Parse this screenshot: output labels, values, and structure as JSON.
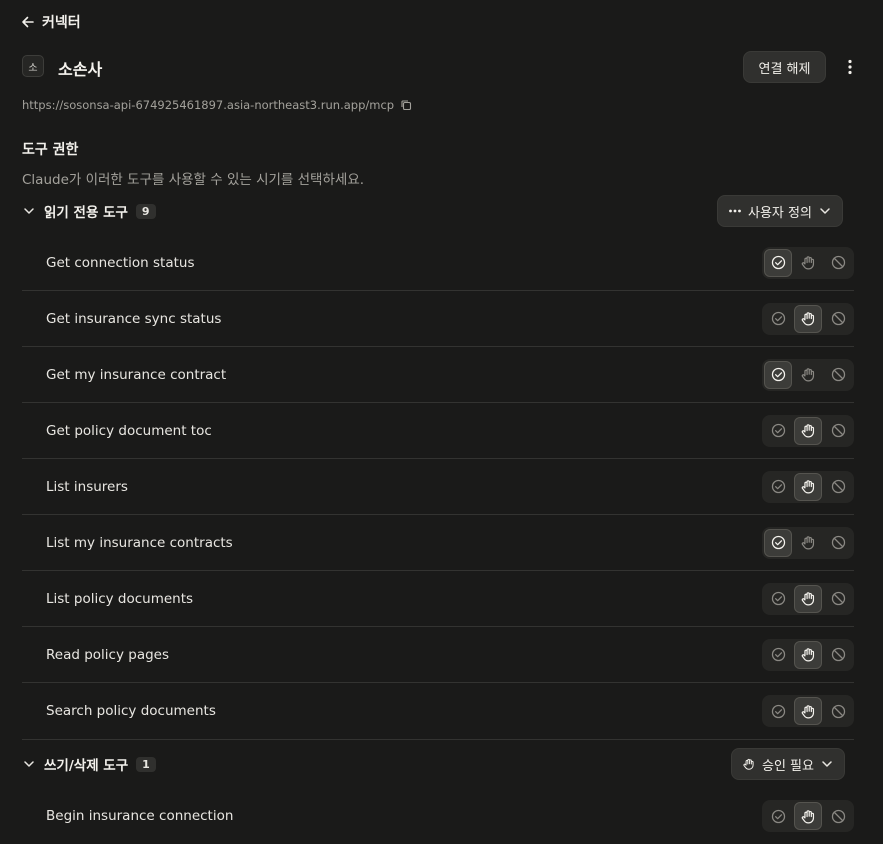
{
  "nav": {
    "back_label": "커넥터"
  },
  "connector": {
    "badge": "소",
    "name": "소손사",
    "disconnect_label": "연결 해제",
    "url": "https://sosonsa-api-674925461897.asia-northeast3.run.app/mcp"
  },
  "permissions": {
    "title": "도구 권한",
    "subtitle": "Claude가 이러한 도구를 사용할 수 있는 시기를 선택하세요."
  },
  "read_group": {
    "title": "읽기 전용 도구",
    "count": "9",
    "dropdown_label": "사용자 정의",
    "tools": [
      {
        "label": "Get connection status",
        "mode": "allow"
      },
      {
        "label": "Get insurance sync status",
        "mode": "ask"
      },
      {
        "label": "Get my insurance contract",
        "mode": "allow"
      },
      {
        "label": "Get policy document toc",
        "mode": "ask"
      },
      {
        "label": "List insurers",
        "mode": "ask"
      },
      {
        "label": "List my insurance contracts",
        "mode": "allow"
      },
      {
        "label": "List policy documents",
        "mode": "ask"
      },
      {
        "label": "Read policy pages",
        "mode": "ask"
      },
      {
        "label": "Search policy documents",
        "mode": "ask"
      }
    ]
  },
  "write_group": {
    "title": "쓰기/삭제 도구",
    "count": "1",
    "dropdown_label": "승인 필요",
    "tools": [
      {
        "label": "Begin insurance connection",
        "mode": "ask"
      }
    ]
  }
}
